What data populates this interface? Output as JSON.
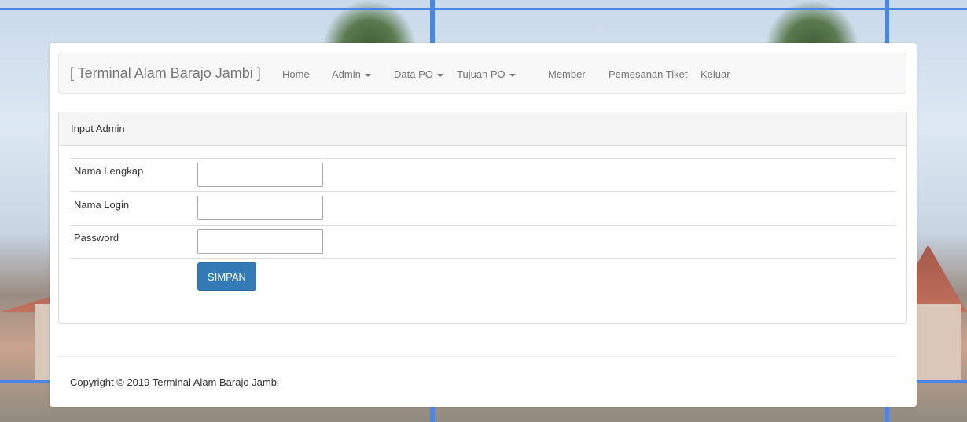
{
  "navbar": {
    "brand": "[ Terminal Alam Barajo Jambi ]",
    "items": [
      {
        "label": "Home",
        "dropdown": false
      },
      {
        "label": "Admin",
        "dropdown": true
      },
      {
        "label": "Data PO",
        "dropdown": true
      },
      {
        "label": "Tujuan PO",
        "dropdown": true
      },
      {
        "label": "Member",
        "dropdown": false
      },
      {
        "label": "Pemesanan Tiket",
        "dropdown": false
      },
      {
        "label": "Keluar",
        "dropdown": false
      }
    ]
  },
  "panel": {
    "title": "Input Admin",
    "fields": [
      {
        "label": "Nama Lengkap",
        "value": "",
        "placeholder": ""
      },
      {
        "label": "Nama Login",
        "value": "",
        "placeholder": ""
      },
      {
        "label": "Password",
        "value": "",
        "placeholder": ""
      }
    ],
    "submit_label": "SIMPAN"
  },
  "footer": {
    "copyright": "Copyright © 2019 Terminal Alam Barajo Jambi"
  },
  "colors": {
    "primary_button": "#337ab7",
    "background_frame": "#4a86e8"
  }
}
